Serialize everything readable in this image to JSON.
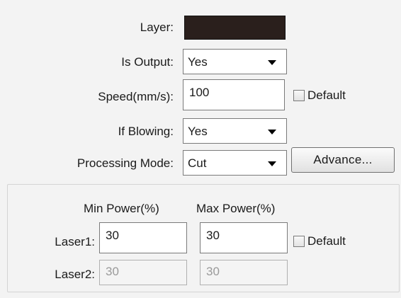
{
  "settings": {
    "layer_label": "Layer:",
    "layer_color": "#2a1f1c",
    "is_output_label": "Is Output:",
    "is_output_value": "Yes",
    "speed_label": "Speed(mm/s):",
    "speed_value": "100",
    "speed_default_label": "Default",
    "if_blowing_label": "If Blowing:",
    "if_blowing_value": "Yes",
    "processing_mode_label": "Processing Mode:",
    "processing_mode_value": "Cut",
    "advance_button_label": "Advance..."
  },
  "power": {
    "min_power_header": "Min Power(%)",
    "max_power_header": "Max Power(%)",
    "laser1": {
      "label": "Laser1:",
      "min": "30",
      "max": "30",
      "default_label": "Default"
    },
    "laser2": {
      "label": "Laser2:",
      "min": "30",
      "max": "30"
    }
  }
}
